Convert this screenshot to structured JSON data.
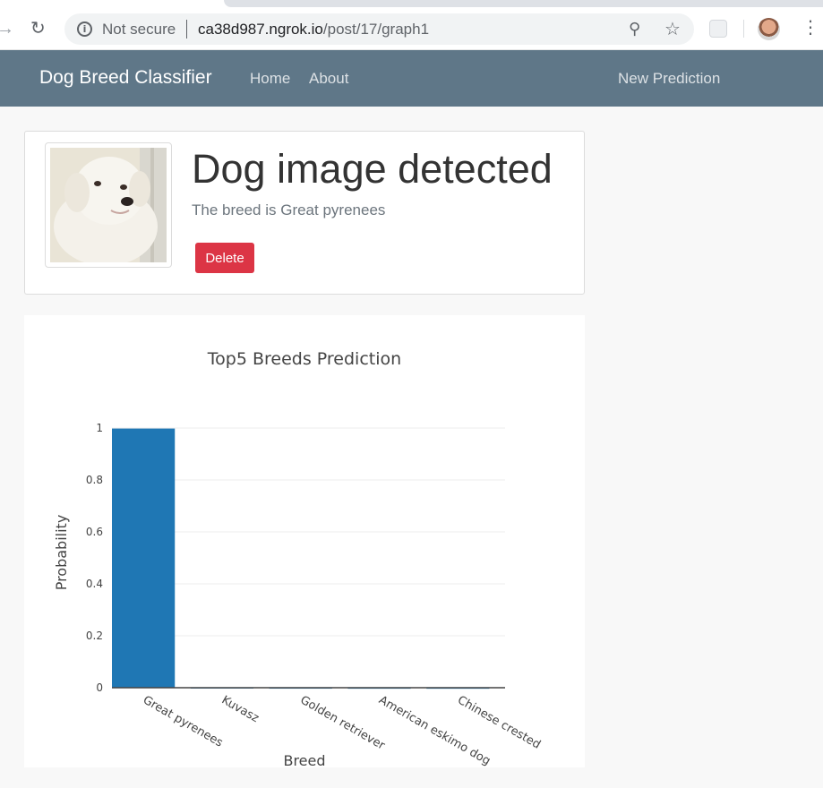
{
  "browser": {
    "security_label": "Not secure",
    "url_host": "ca38d987.ngrok.io",
    "url_path": "/post/17/graph1",
    "icons": [
      "forward-icon",
      "reload-icon",
      "info-icon",
      "zoom-icon",
      "star-icon",
      "extension-icon",
      "avatar",
      "menu-icon"
    ]
  },
  "navbar": {
    "brand": "Dog Breed Classifier",
    "links": [
      "Home",
      "About"
    ],
    "new_prediction": "New Prediction",
    "color": "#5f7788"
  },
  "card": {
    "title": "Dog image detected",
    "subtitle": "The breed is Great pyrenees",
    "delete_label": "Delete",
    "delete_color": "#dc3545"
  },
  "chart_data": {
    "type": "bar",
    "title": "Top5 Breeds Prediction",
    "xlabel": "Breed",
    "ylabel": "Probability",
    "categories": [
      "Great pyrenees",
      "Kuvasz",
      "Golden retriever",
      "American eskimo dog",
      "Chinese crested"
    ],
    "values": [
      0.998,
      0.001,
      0.0005,
      0.0003,
      0.0002
    ],
    "ylim": [
      0,
      1
    ],
    "yticks": [
      "0",
      "0.2",
      "0.4",
      "0.6",
      "0.8",
      "1"
    ],
    "grid": true,
    "bar_color": "#1f77b4"
  }
}
